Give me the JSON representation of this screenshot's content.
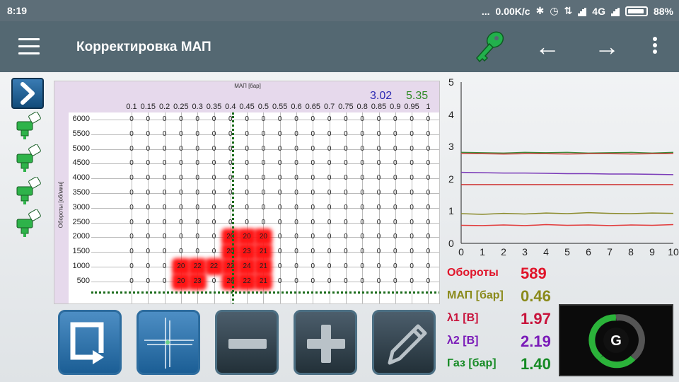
{
  "status_bar": {
    "time": "8:19",
    "dots": "...",
    "speed": "0.00K/c",
    "network": "4G",
    "battery": "88%"
  },
  "toolbar": {
    "title": "Корректировка МАП",
    "back_glyph": "←",
    "forward_glyph": "→",
    "icons": [
      "menu-icon",
      "key-icon",
      "arrow-back-icon",
      "arrow-forward-icon",
      "more-vert-icon"
    ],
    "key_color": "#22b14c"
  },
  "map": {
    "xlabel": "МАП [бар]",
    "ylabel": "Обороты [об/мин]",
    "top_value_1": "3.02",
    "top_value_2": "5.35",
    "x_ticks": [
      "0.1",
      "0.15",
      "0.2",
      "0.25",
      "0.3",
      "0.35",
      "0.4",
      "0.45",
      "0.5",
      "0.55",
      "0.6",
      "0.65",
      "0.7",
      "0.75",
      "0.8",
      "0.85",
      "0.9",
      "0.95",
      "1"
    ],
    "y_ticks": [
      "6000",
      "5500",
      "5000",
      "4500",
      "4000",
      "3500",
      "3000",
      "2500",
      "2000",
      "1500",
      "1000",
      "500"
    ],
    "rows": [
      [
        "0",
        "0",
        "0",
        "0",
        "0",
        "0",
        "0",
        "0",
        "0",
        "0",
        "0",
        "0",
        "0",
        "0",
        "0",
        "0",
        "0",
        "0",
        "0"
      ],
      [
        "0",
        "0",
        "0",
        "0",
        "0",
        "0",
        "0",
        "0",
        "0",
        "0",
        "0",
        "0",
        "0",
        "0",
        "0",
        "0",
        "0",
        "0",
        "0"
      ],
      [
        "0",
        "0",
        "0",
        "0",
        "0",
        "0",
        "0",
        "0",
        "0",
        "0",
        "0",
        "0",
        "0",
        "0",
        "0",
        "0",
        "0",
        "0",
        "0"
      ],
      [
        "0",
        "0",
        "0",
        "0",
        "0",
        "0",
        "0",
        "0",
        "0",
        "0",
        "0",
        "0",
        "0",
        "0",
        "0",
        "0",
        "0",
        "0",
        "0"
      ],
      [
        "0",
        "0",
        "0",
        "0",
        "0",
        "0",
        "0",
        "0",
        "0",
        "0",
        "0",
        "0",
        "0",
        "0",
        "0",
        "0",
        "0",
        "0",
        "0"
      ],
      [
        "0",
        "0",
        "0",
        "0",
        "0",
        "0",
        "0",
        "0",
        "0",
        "0",
        "0",
        "0",
        "0",
        "0",
        "0",
        "0",
        "0",
        "0",
        "0"
      ],
      [
        "0",
        "0",
        "0",
        "0",
        "0",
        "0",
        "0",
        "0",
        "0",
        "0",
        "0",
        "0",
        "0",
        "0",
        "0",
        "0",
        "0",
        "0",
        "0"
      ],
      [
        "0",
        "0",
        "0",
        "0",
        "0",
        "0",
        "0",
        "0",
        "0",
        "0",
        "0",
        "0",
        "0",
        "0",
        "0",
        "0",
        "0",
        "0",
        "0"
      ],
      [
        "0",
        "0",
        "0",
        "0",
        "0",
        "0",
        "20",
        "20",
        "20",
        "0",
        "0",
        "0",
        "0",
        "0",
        "0",
        "0",
        "0",
        "0",
        "0"
      ],
      [
        "0",
        "0",
        "0",
        "0",
        "0",
        "0",
        "20",
        "23",
        "21",
        "0",
        "0",
        "0",
        "0",
        "0",
        "0",
        "0",
        "0",
        "0",
        "0"
      ],
      [
        "0",
        "0",
        "0",
        "20",
        "22",
        "22",
        "22",
        "24",
        "21",
        "0",
        "0",
        "0",
        "0",
        "0",
        "0",
        "0",
        "0",
        "0",
        "0"
      ],
      [
        "0",
        "0",
        "0",
        "20",
        "23",
        "0",
        "26",
        "22",
        "21",
        "0",
        "0",
        "0",
        "0",
        "0",
        "0",
        "0",
        "0",
        "0",
        "0"
      ]
    ],
    "heat_color": "#ff1515"
  },
  "plot": {
    "chart_data": {
      "type": "line",
      "x": [
        0,
        1,
        2,
        3,
        4,
        5,
        6,
        7,
        8,
        9,
        10
      ],
      "xlim": [
        0,
        10
      ],
      "ylim": [
        0,
        5
      ],
      "x_ticks": [
        "0",
        "1",
        "2",
        "3",
        "4",
        "5",
        "6",
        "7",
        "8",
        "9",
        "10"
      ],
      "y_ticks": [
        "0",
        "1",
        "2",
        "3",
        "4",
        "5"
      ],
      "grid": false,
      "series": [
        {
          "color": "#3a8a3a",
          "values": [
            2.82,
            2.81,
            2.8,
            2.82,
            2.81,
            2.82,
            2.8,
            2.81,
            2.82,
            2.8,
            2.82
          ]
        },
        {
          "color": "#d84a4a",
          "values": [
            2.78,
            2.78,
            2.77,
            2.78,
            2.78,
            2.77,
            2.78,
            2.78,
            2.77,
            2.78,
            2.78
          ]
        },
        {
          "color": "#7a3ab8",
          "values": [
            2.2,
            2.19,
            2.18,
            2.18,
            2.17,
            2.16,
            2.16,
            2.15,
            2.15,
            2.14,
            2.13
          ]
        },
        {
          "color": "#cc2a2a",
          "values": [
            1.82,
            1.82,
            1.82,
            1.82,
            1.82,
            1.82,
            1.82,
            1.82,
            1.82,
            1.82,
            1.82
          ]
        },
        {
          "color": "#8a8a2a",
          "values": [
            0.92,
            0.9,
            0.93,
            0.91,
            0.94,
            0.92,
            0.95,
            0.93,
            0.92,
            0.94,
            0.93
          ]
        },
        {
          "color": "#e23a3a",
          "values": [
            0.56,
            0.55,
            0.57,
            0.55,
            0.58,
            0.56,
            0.57,
            0.55,
            0.57,
            0.56,
            0.58
          ]
        }
      ]
    }
  },
  "readouts": [
    {
      "label": "Обороты",
      "value": "589",
      "label_color": "#e0142a",
      "value_color": "#e0142a"
    },
    {
      "label": "МАП [бар]",
      "value": "0.46",
      "label_color": "#8a8a1a",
      "value_color": "#8a8a1a"
    },
    {
      "label": "λ1 [В]",
      "value": "1.97",
      "label_color": "#c8143c",
      "value_color": "#c8143c"
    },
    {
      "label": "λ2 [В]",
      "value": "2.19",
      "label_color": "#7a1ab8",
      "value_color": "#7a1ab8"
    },
    {
      "label": "Газ [бар]",
      "value": "1.40",
      "label_color": "#158a24",
      "value_color": "#158a24"
    }
  ],
  "bottom_tools": [
    "export-icon",
    "crosshair-icon",
    "minus-icon",
    "plus-icon",
    "pencil-icon"
  ],
  "logo": {
    "letter": "G",
    "ring_colors": [
      "#2bb33a",
      "#666666"
    ]
  }
}
